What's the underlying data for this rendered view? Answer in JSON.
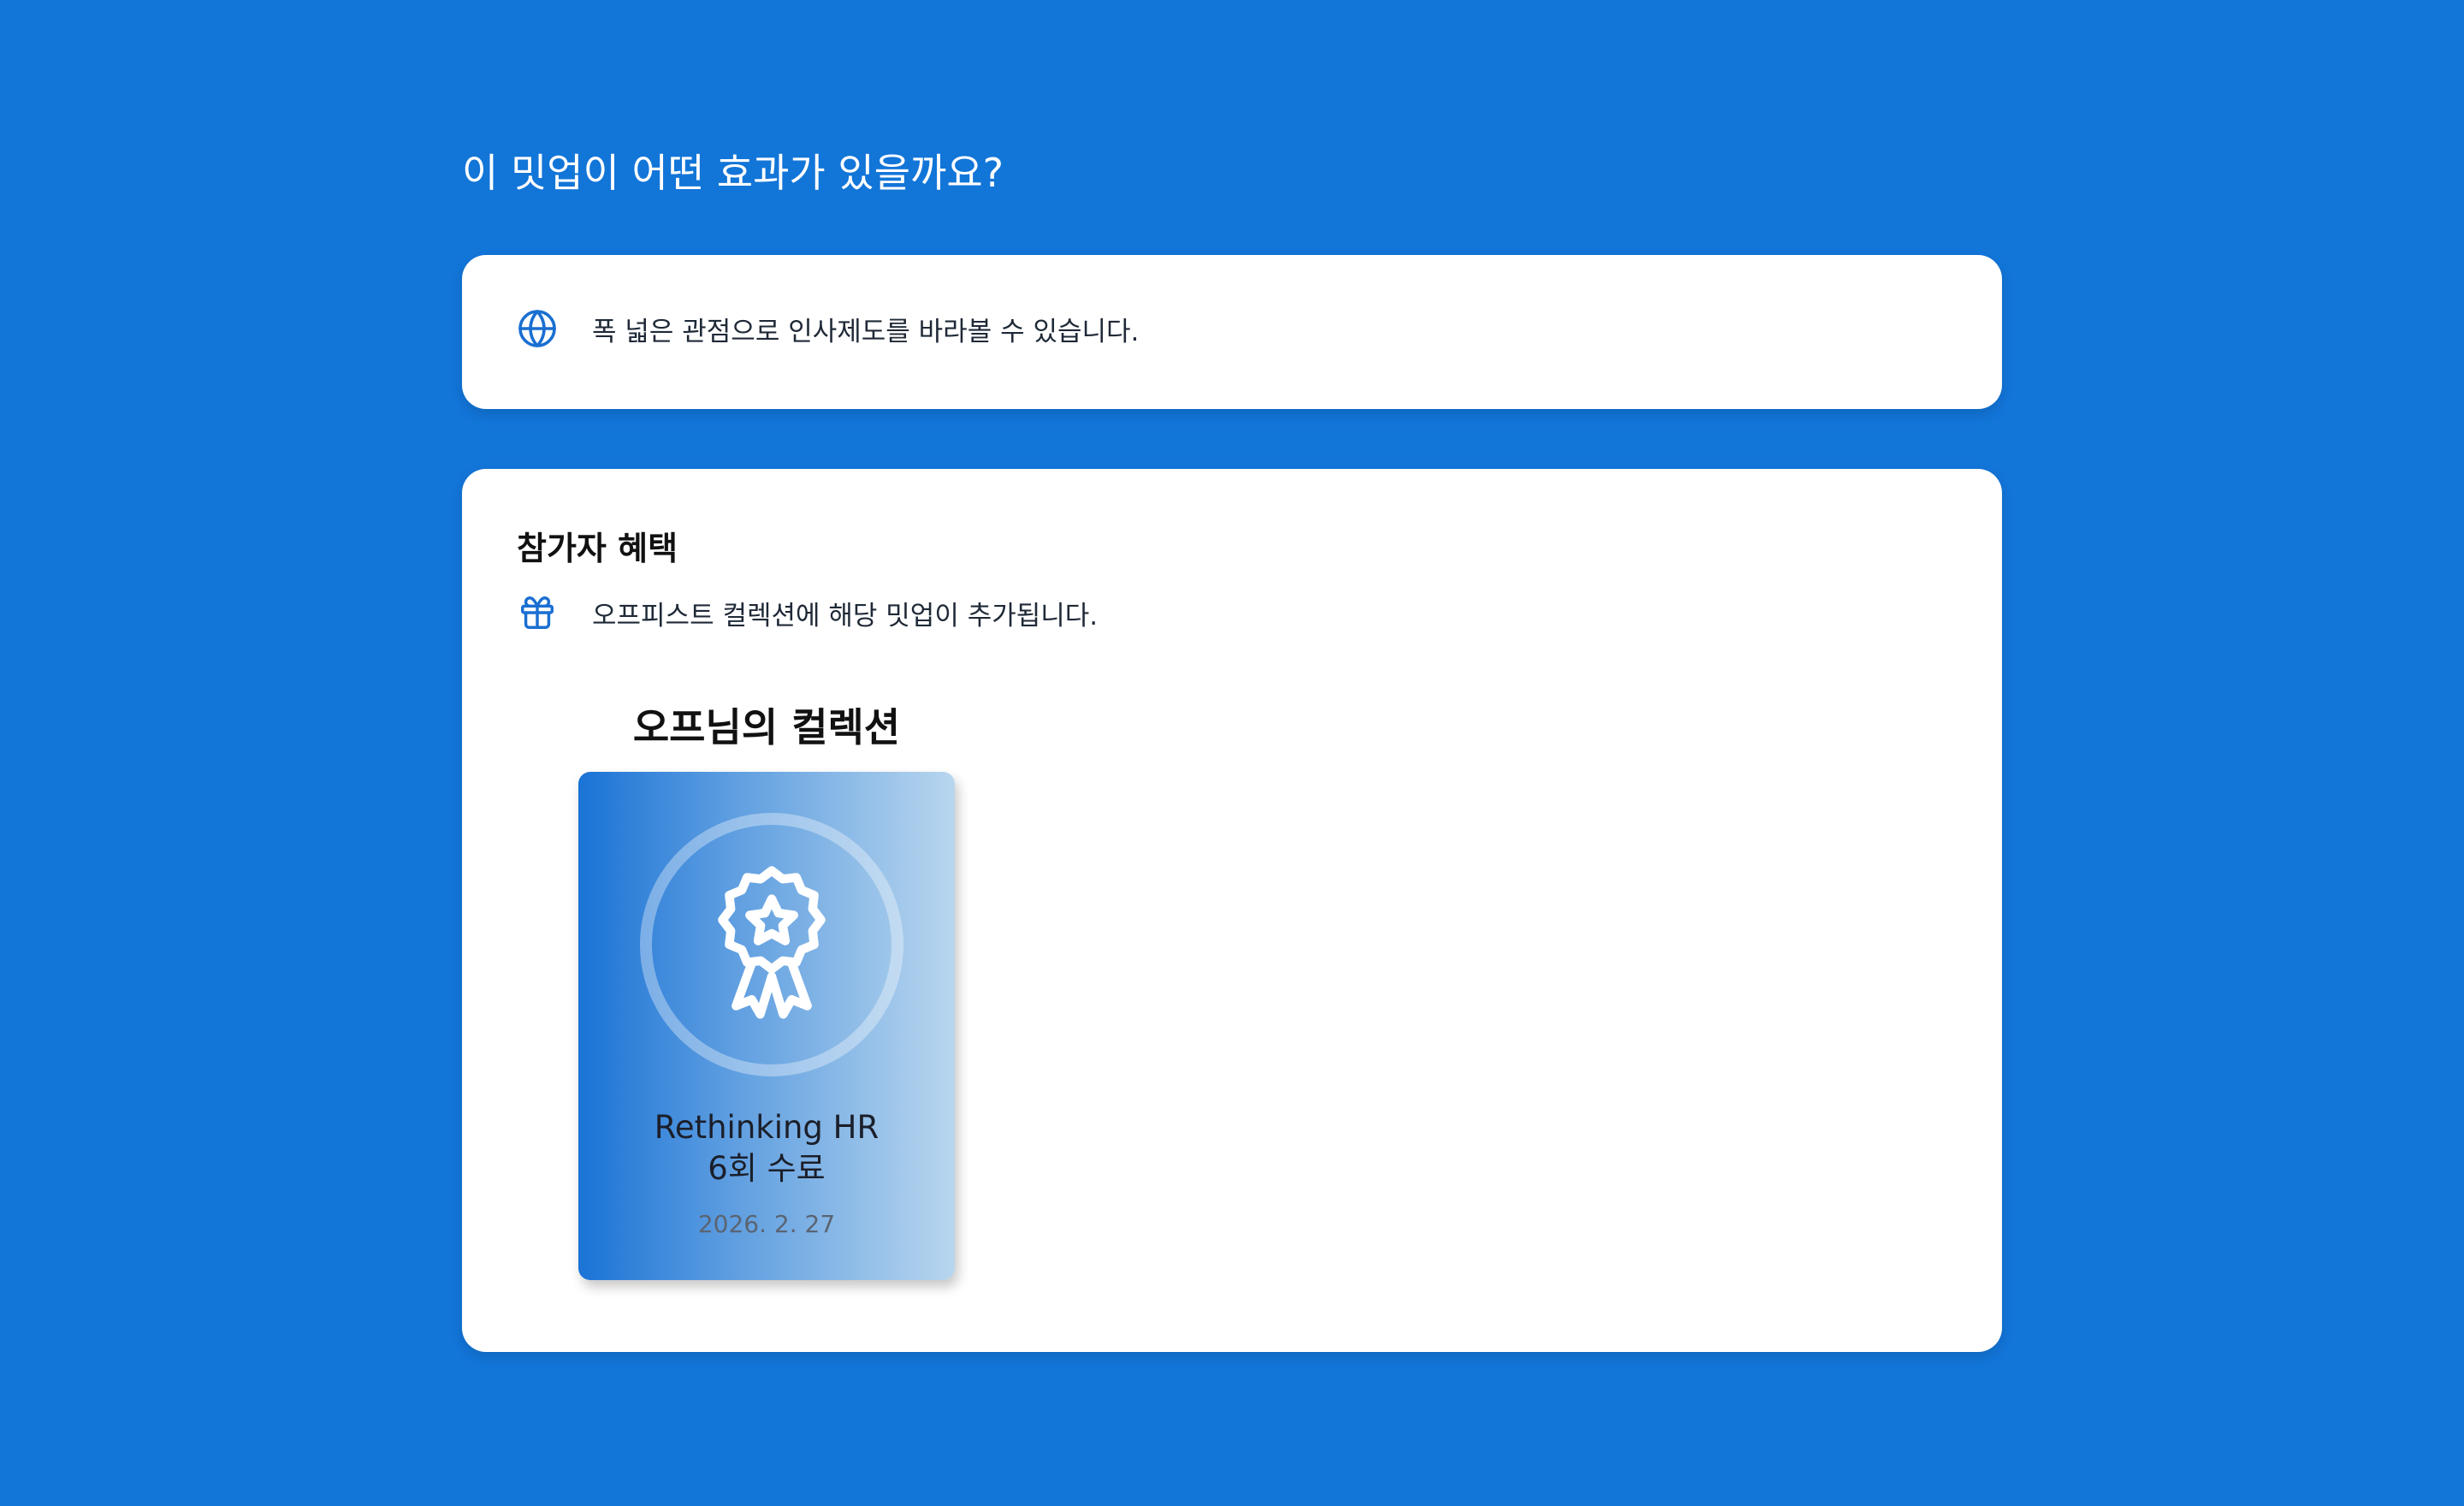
{
  "effect": {
    "title": "이 밋업이 어떤 효과가 있을까요?",
    "items": [
      {
        "icon": "globe-icon",
        "text": "폭 넓은 관점으로 인사제도를 바라볼 수 있습니다."
      }
    ]
  },
  "benefit": {
    "title": "참가자 혜택",
    "items": [
      {
        "icon": "gift-icon",
        "text": "오프피스트 컬렉션에 해당 밋업이 추가됩니다."
      }
    ],
    "collection": {
      "title": "오프님의 컬렉션",
      "badge": {
        "icon": "award-icon",
        "name": "Rethinking HR",
        "sub": "6회 수료",
        "date": "2026. 2. 27"
      }
    }
  },
  "colors": {
    "background": "#1275d8",
    "accent": "#1a73d6",
    "card": "#ffffff"
  }
}
